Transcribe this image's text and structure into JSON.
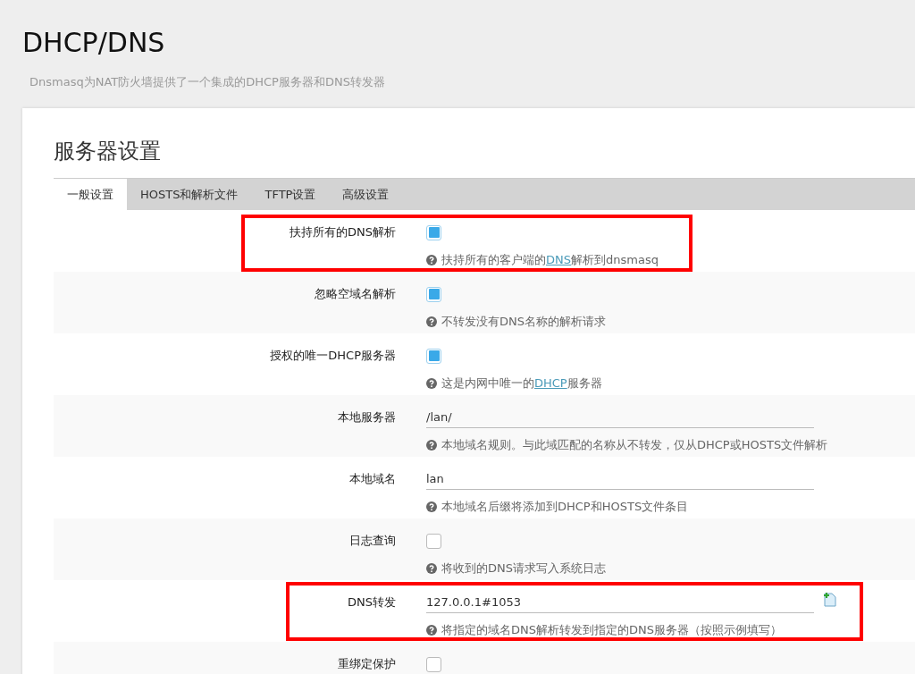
{
  "page": {
    "title": "DHCP/DNS",
    "description": "Dnsmasq为NAT防火墙提供了一个集成的DHCP服务器和DNS转发器"
  },
  "section": {
    "title": "服务器设置"
  },
  "tabs": [
    {
      "label": "一般设置",
      "selected": true
    },
    {
      "label": "HOSTS和解析文件",
      "selected": false
    },
    {
      "label": "TFTP设置",
      "selected": false
    },
    {
      "label": "高级设置",
      "selected": false
    }
  ],
  "rows": [
    {
      "kind": "checkbox",
      "label": "扶持所有的DNS解析",
      "checked": true,
      "highlighted": true,
      "help": [
        {
          "text": "扶持所有的客户端的"
        },
        {
          "text": "DNS",
          "link": true
        },
        {
          "text": "解析到dnsmasq"
        }
      ]
    },
    {
      "kind": "checkbox",
      "label": "忽略空域名解析",
      "checked": true,
      "highlighted": false,
      "help": [
        {
          "text": "不转发没有DNS名称的解析请求"
        }
      ]
    },
    {
      "kind": "checkbox",
      "label": "授权的唯一DHCP服务器",
      "checked": true,
      "highlighted": false,
      "help": [
        {
          "text": "这是内网中唯一的"
        },
        {
          "text": "DHCP",
          "link": true
        },
        {
          "text": "服务器"
        }
      ]
    },
    {
      "kind": "text",
      "label": "本地服务器",
      "value": "/lan/",
      "highlighted": false,
      "help": [
        {
          "text": "本地域名规则。与此域匹配的名称从不转发，仅从DHCP或HOSTS文件解析"
        }
      ]
    },
    {
      "kind": "text",
      "label": "本地域名",
      "value": "lan",
      "highlighted": false,
      "help": [
        {
          "text": "本地域名后缀将添加到DHCP和HOSTS文件条目"
        }
      ]
    },
    {
      "kind": "checkbox",
      "label": "日志查询",
      "checked": false,
      "highlighted": false,
      "help": [
        {
          "text": "将收到的DNS请求写入系统日志"
        }
      ]
    },
    {
      "kind": "list",
      "label": "DNS转发",
      "value": "127.0.0.1#1053",
      "highlighted": true,
      "help": [
        {
          "text": "将指定的域名DNS解析转发到指定的DNS服务器（按照示例填写）"
        }
      ]
    },
    {
      "kind": "checkbox",
      "label": "重绑定保护",
      "checked": false,
      "highlighted": false
    }
  ]
}
